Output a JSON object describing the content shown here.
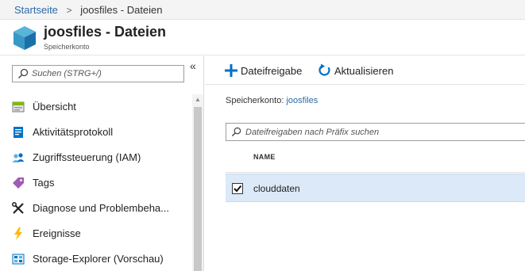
{
  "breadcrumb": {
    "home": "Startseite",
    "separator": ">",
    "current": "joosfiles - Dateien"
  },
  "header": {
    "title": "joosfiles - Dateien",
    "subtitle": "Speicherkonto",
    "logo_icon": "storage-cube-icon"
  },
  "sidebar": {
    "search_placeholder": "Suchen (STRG+/)",
    "collapse_label": "«",
    "items": [
      {
        "label": "Übersicht",
        "icon": "overview-icon"
      },
      {
        "label": "Aktivitätsprotokoll",
        "icon": "activity-log-icon"
      },
      {
        "label": "Zugriffssteuerung (IAM)",
        "icon": "iam-icon"
      },
      {
        "label": "Tags",
        "icon": "tag-icon"
      },
      {
        "label": "Diagnose und Problembeha...",
        "icon": "wrench-icon"
      },
      {
        "label": "Ereignisse",
        "icon": "lightning-icon"
      },
      {
        "label": "Storage-Explorer (Vorschau)",
        "icon": "storage-explorer-icon"
      }
    ]
  },
  "toolbar": {
    "add_share_label": "Dateifreigabe",
    "refresh_label": "Aktualisieren"
  },
  "main": {
    "account_label": "Speicherkonto:",
    "account_value": "joosfiles",
    "share_search_placeholder": "Dateifreigaben nach Präfix suchen",
    "column_name": "NAME",
    "rows": [
      {
        "name": "clouddaten",
        "checked": true
      }
    ]
  },
  "colors": {
    "accent": "#2b6aa6",
    "selected_row": "#dbe9f8",
    "breadcrumb_bg": "#f4f4f4"
  }
}
